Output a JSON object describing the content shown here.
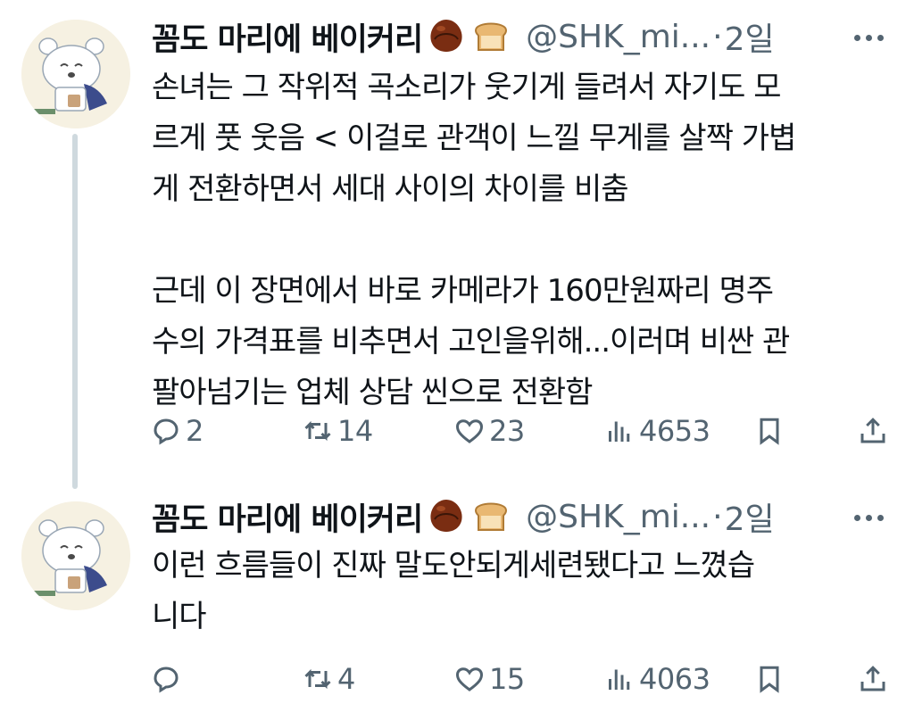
{
  "tweets": [
    {
      "display_name": "꼼도 마리에 베이커리",
      "handle": "@SHK_mi...",
      "separator": "·",
      "time": "2일",
      "text": "손녀는 그 작위적 곡소리가 웃기게 들려서 자기도 모\n르게 풋 웃음 < 이걸로 관객이 느낄 무게를 살짝 가볍\n게 전환하면서 세대 사이의 차이를 비춤\n\n근데 이 장면에서 바로 카메라가  160만원짜리 명주\n수의 가격표를 비추면서 고인을위해...이러며 비싼 관\n팔아넘기는 업체 상담 씬으로 전환함",
      "replies": "2",
      "retweets": "14",
      "likes": "23",
      "views": "4653"
    },
    {
      "display_name": "꼼도 마리에 베이커리",
      "handle": "@SHK_mi...",
      "separator": "·",
      "time": "2일",
      "text": "이런 흐름들이 진짜 말도안되게세련됐다고 느꼈습\n니다",
      "replies": "",
      "retweets": "4",
      "likes": "15",
      "views": "4063"
    }
  ],
  "icons": {
    "name_emoji_1": "chestnut-icon",
    "name_emoji_2": "bread-icon",
    "more": "more-icon",
    "reply": "reply-icon",
    "retweet": "retweet-icon",
    "like": "heart-icon",
    "views": "views-icon",
    "bookmark": "bookmark-icon",
    "share": "share-icon"
  },
  "colors": {
    "text": "#0f1419",
    "secondary": "#536471",
    "thread_line": "#cfd9de"
  }
}
